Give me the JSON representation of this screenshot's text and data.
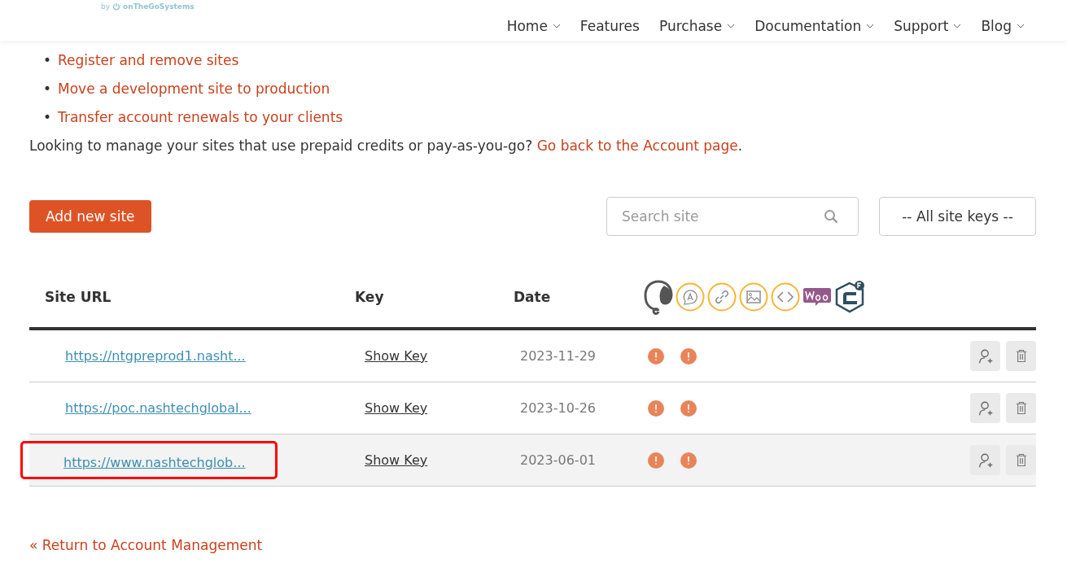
{
  "header": {
    "byline": "by",
    "brand": "onTheGoSystems",
    "nav": [
      {
        "label": "Home",
        "dropdown": true
      },
      {
        "label": "Features",
        "dropdown": false
      },
      {
        "label": "Purchase",
        "dropdown": true
      },
      {
        "label": "Documentation",
        "dropdown": true
      },
      {
        "label": "Support",
        "dropdown": true
      },
      {
        "label": "Blog",
        "dropdown": true
      }
    ]
  },
  "links": [
    {
      "marker": "•",
      "label": "Register and remove sites"
    },
    {
      "marker": "•",
      "label": "Move a development site to production"
    },
    {
      "marker": "•",
      "label": "Transfer account renewals to your clients"
    }
  ],
  "note": {
    "text": "Looking to manage your sites that use prepaid credits or pay-as-you-go?",
    "link": "Go back to the Account page",
    "end": "."
  },
  "toolbar": {
    "add_button": "Add new site",
    "search": {
      "placeholder": "Search site"
    },
    "key_filter": "-- All site keys --"
  },
  "table": {
    "columns": [
      "Site URL",
      "Key",
      "Date"
    ],
    "rows": [
      {
        "url": "https://ntgpreprod1.nasht...",
        "key": "Show Key",
        "date": "2023-11-29",
        "hovered": false,
        "highlighted": false
      },
      {
        "url": "https://poc.nashtechglobal...",
        "key": "Show Key",
        "date": "2023-10-26",
        "hovered": false,
        "highlighted": false
      },
      {
        "url": "https://www.nashtechglob...",
        "key": "Show Key",
        "date": "2023-06-01",
        "hovered": true,
        "highlighted": true
      }
    ]
  },
  "footer_link": "« Return to Account Management"
}
